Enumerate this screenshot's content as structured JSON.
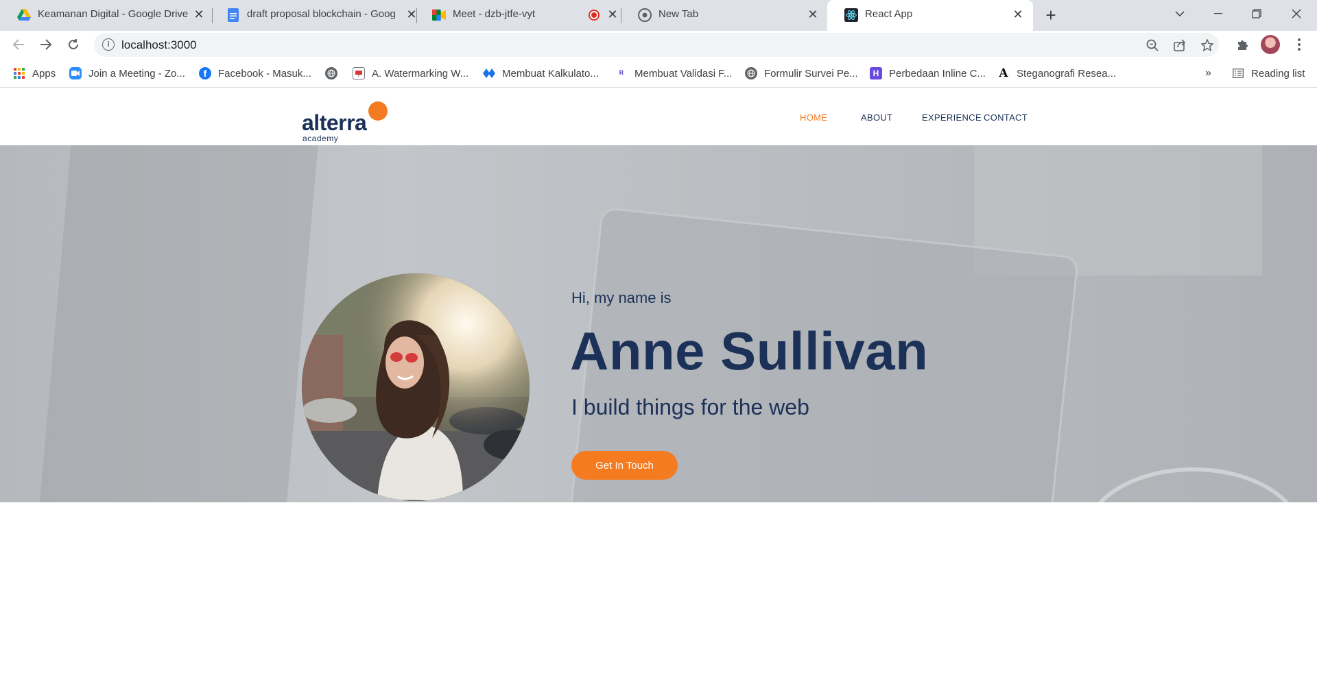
{
  "browser": {
    "tabs": [
      {
        "title": "Keamanan Digital - Google Drive",
        "icon": "google-drive-icon"
      },
      {
        "title": "draft proposal blockchain - Goog",
        "icon": "google-docs-icon"
      },
      {
        "title": "Meet - dzb-jtfe-vyt",
        "icon": "google-meet-icon"
      },
      {
        "title": "New Tab",
        "icon": "chrome-icon"
      },
      {
        "title": "React App",
        "icon": "react-icon"
      }
    ],
    "url": "localhost:3000",
    "bookmarks": [
      {
        "label": "Apps",
        "icon": "apps-grid-icon"
      },
      {
        "label": "Join a Meeting - Zo...",
        "icon": "zoom-icon"
      },
      {
        "label": "Facebook - Masuk...",
        "icon": "facebook-icon"
      },
      {
        "label": "",
        "icon": "globe-icon"
      },
      {
        "label": "A. Watermarking W...",
        "icon": "presentation-icon"
      },
      {
        "label": "Membuat Kalkulato...",
        "icon": "codepen-diamond-icon"
      },
      {
        "label": "Membuat Validasi F...",
        "icon": "bookmark-a-icon"
      },
      {
        "label": "Formulir Survei Pe...",
        "icon": "globe-icon"
      },
      {
        "label": "Perbedaan Inline C...",
        "icon": "h-logo-icon"
      },
      {
        "label": "Steganografi Resea...",
        "icon": "a-serif-icon"
      }
    ],
    "reading_list": "Reading list",
    "more_bookmarks": "»"
  },
  "site": {
    "logo_word": "alterra",
    "logo_sub": "academy",
    "nav": [
      "HOME",
      "ABOUT",
      "EXPERIENCE",
      "CONTACT"
    ],
    "active_nav": "HOME",
    "hero": {
      "greeting": "Hi, my name is",
      "name": "Anne Sullivan",
      "tagline": "I build things for the web",
      "cta_label": "Get In Touch"
    },
    "colors": {
      "accent": "#f47b20",
      "text": "#1b3157"
    }
  }
}
